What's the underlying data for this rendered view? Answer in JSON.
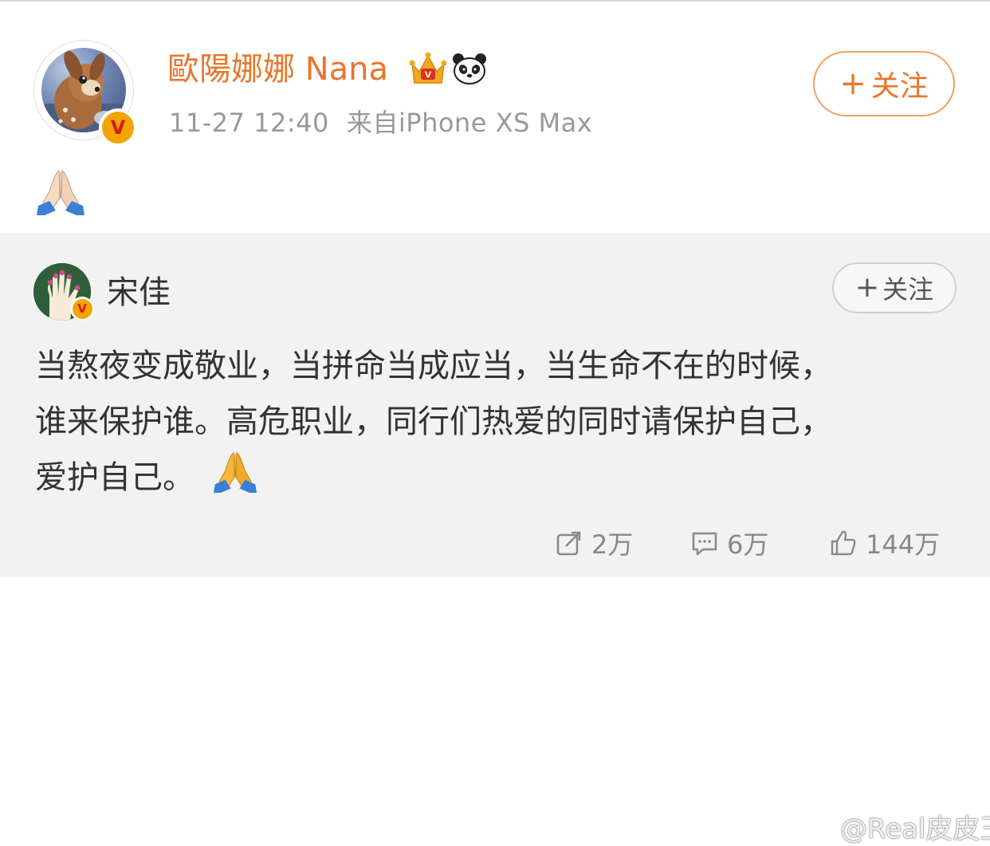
{
  "post": {
    "author": "歐陽娜娜 Nana",
    "time": "11-27 12:40",
    "source": "来自iPhone XS Max",
    "follow_label": "关注",
    "content_emoji": "folded-hands-light-skin"
  },
  "repost": {
    "author": "宋佳",
    "follow_label": "关注",
    "text_lines": [
      "当熬夜变成敬业，当拼命当成应当，当生命不在的时候，",
      "谁来保护谁。高危职业，同行们热爱的同时请保护自己，",
      "爱护自己。"
    ],
    "trailing_emoji": "folded-hands"
  },
  "actions": {
    "repost_count": "2万",
    "comment_count": "6万",
    "like_count": "144万"
  },
  "watermark": "@Real皮皮王",
  "colors": {
    "accent": "#e9762b",
    "verified_gold": "#f2a400",
    "verified_red": "#d21d1d",
    "repost_bg": "#f2f2f2"
  }
}
